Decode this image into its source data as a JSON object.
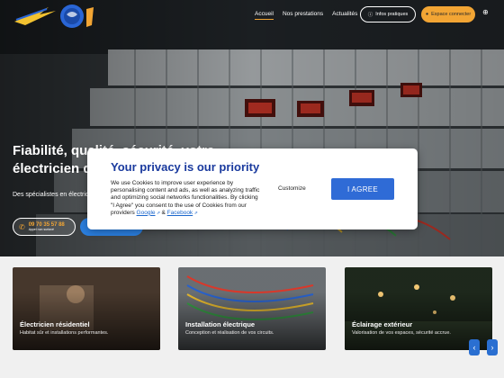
{
  "header": {
    "nav": [
      {
        "label": "Accueil"
      },
      {
        "label": "Nos prestations"
      },
      {
        "label": "Actualités"
      }
    ],
    "info_button": "Infos pratiques",
    "connect_button": "Espace connecter",
    "lang_icon": "globe-icon"
  },
  "hero": {
    "title": "Fiabilité, qualité, sécurité, votre électricien de confiance",
    "subtitle": "Des spécialistes en électricité industrielle et tertiaire",
    "phone": "09 70 35 57 88",
    "phone_note": "Appel non surtaxé"
  },
  "cards": [
    {
      "title": "Électricien résidentiel",
      "desc": "Habitat sûr et installations performantes."
    },
    {
      "title": "Installation électrique",
      "desc": "Conception et réalisation de vos circuits."
    },
    {
      "title": "Éclairage extérieur",
      "desc": "Valorisation de vos espaces, sécurité accrue."
    }
  ],
  "modal": {
    "title": "Your privacy is our priority",
    "text": "We use Cookies to improve user experience by personalising content and ads, as well as analyzing traffic and optimizing social networks functionalities. By clicking \"I Agree\" you consent to the use of Cookies from our providers",
    "link_google": "Google",
    "link_and": "&",
    "link_facebook": "Facebook",
    "customize_label": "Customize",
    "agree_label": "I AGREE"
  },
  "colors": {
    "accent_orange": "#f2a534",
    "primary_blue": "#2f6bd6",
    "title_blue": "#1a3a9e"
  }
}
